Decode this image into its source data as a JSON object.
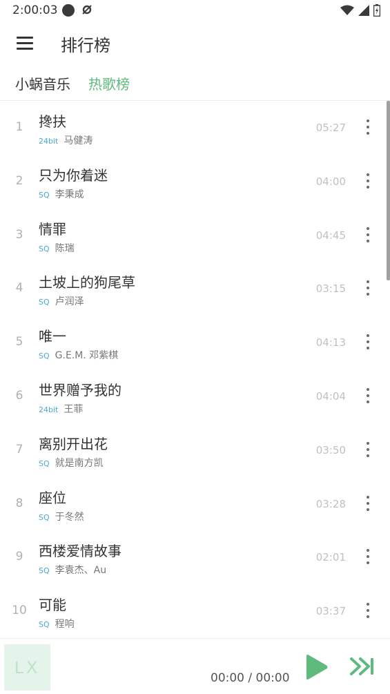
{
  "status_bar": {
    "time": "2:00:03",
    "icons": [
      "circle-notification-icon",
      "misc-notification-icon",
      "wifi-icon",
      "signal-icon",
      "battery-charging-icon"
    ]
  },
  "app_bar": {
    "title": "排行榜",
    "menu_icon": "hamburger-menu-icon"
  },
  "source": {
    "name": "小蜗音乐",
    "board": "热歌榜",
    "board_color": "#5fba7d"
  },
  "songs": [
    {
      "index": "1",
      "name": "搀扶",
      "quality": "24bit",
      "artist": "马健涛",
      "duration": "05:27"
    },
    {
      "index": "2",
      "name": "只为你着迷",
      "quality": "SQ",
      "artist": "李秉成",
      "duration": "04:00"
    },
    {
      "index": "3",
      "name": "情罪",
      "quality": "SQ",
      "artist": "陈瑞",
      "duration": "04:45"
    },
    {
      "index": "4",
      "name": "土坡上的狗尾草",
      "quality": "SQ",
      "artist": "卢润泽",
      "duration": "03:15"
    },
    {
      "index": "5",
      "name": "唯一",
      "quality": "SQ",
      "artist": "G.E.M. 邓紫棋",
      "duration": "04:13"
    },
    {
      "index": "6",
      "name": "世界赠予我的",
      "quality": "24bit",
      "artist": "王菲",
      "duration": "04:04"
    },
    {
      "index": "7",
      "name": "离别开出花",
      "quality": "SQ",
      "artist": "就是南方凯",
      "duration": "03:50"
    },
    {
      "index": "8",
      "name": "座位",
      "quality": "SQ",
      "artist": "于冬然",
      "duration": "03:28"
    },
    {
      "index": "9",
      "name": "西楼爱情故事",
      "quality": "SQ",
      "artist": "李袁杰、Au",
      "duration": "02:01"
    },
    {
      "index": "10",
      "name": "可能",
      "quality": "SQ",
      "artist": "程响",
      "duration": "03:37"
    }
  ],
  "player": {
    "cover_text": "LX",
    "time": "00:00 / 00:00",
    "accent_color": "#5fba7d"
  }
}
